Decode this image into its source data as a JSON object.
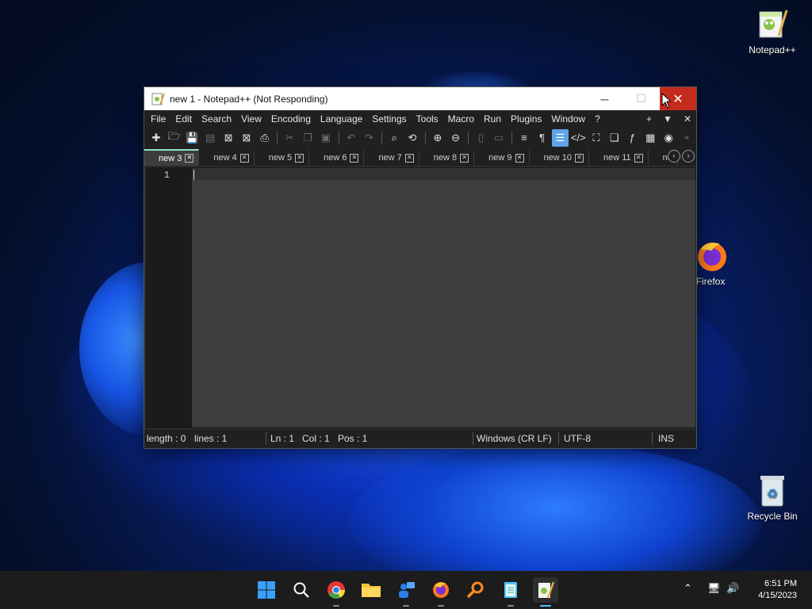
{
  "desktop": {
    "icons": [
      {
        "label": "Notepad++"
      },
      {
        "label": "Firefox"
      },
      {
        "label": "Recycle Bin"
      }
    ]
  },
  "window": {
    "title": "new 1 - Notepad++ (Not Responding)",
    "controls": {
      "minimize": "─",
      "maximize": "☐",
      "close": "✕"
    }
  },
  "menu": {
    "items": [
      "File",
      "Edit",
      "Search",
      "View",
      "Encoding",
      "Language",
      "Settings",
      "Tools",
      "Macro",
      "Run",
      "Plugins",
      "Window",
      "?"
    ],
    "right": [
      "+",
      "▼",
      "✕"
    ]
  },
  "tabs": [
    {
      "label": "new 3",
      "active": true
    },
    {
      "label": "new 4"
    },
    {
      "label": "new 5"
    },
    {
      "label": "new 6"
    },
    {
      "label": "new 7"
    },
    {
      "label": "new 8"
    },
    {
      "label": "new 9"
    },
    {
      "label": "new 10"
    },
    {
      "label": "new 11"
    },
    {
      "label": "ne"
    }
  ],
  "editor": {
    "line_number": "1"
  },
  "status": {
    "length": "length : 0",
    "lines": "lines : 1",
    "ln": "Ln : 1",
    "col": "Col : 1",
    "pos": "Pos : 1",
    "eol": "Windows (CR LF)",
    "encoding": "UTF-8",
    "mode": "INS"
  },
  "taskbar": {
    "time": "6:51 PM",
    "date": "4/15/2023"
  }
}
